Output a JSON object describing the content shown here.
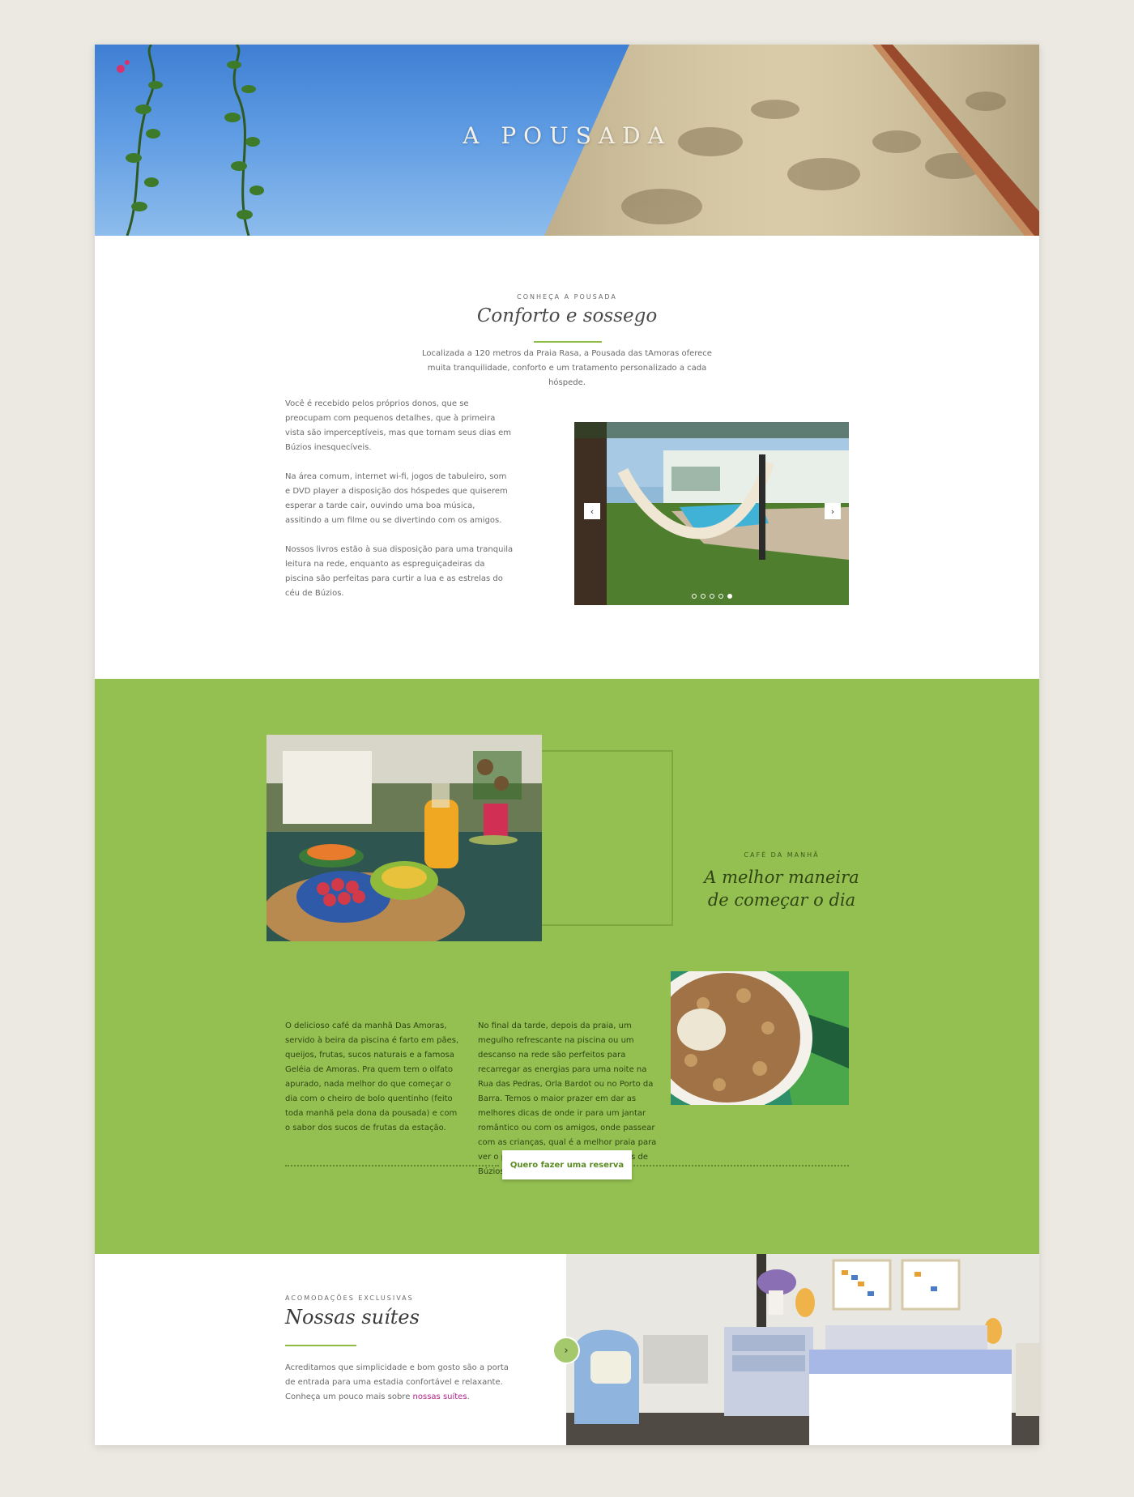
{
  "hero": {
    "title": "A POUSADA"
  },
  "intro": {
    "eyebrow": "CONHEÇA A POUSADA",
    "title": "Conforto e sossego",
    "lead": "Localizada a 120 metros da Praia Rasa, a Pousada das tAmoras oferece muita tranquilidade, conforto e um tratamento personalizado a cada hóspede.",
    "paragraphs": [
      "Você é recebido pelos próprios donos, que se preocupam com pequenos detalhes, que à primeira vista são imperceptíveis, mas que tornam seus dias em Búzios inesquecíveis.",
      "Na área comum, internet wi-fi, jogos de tabuleiro, som e DVD player a disposição dos hóspedes que quiserem esperar a tarde cair, ouvindo uma boa música, assitindo a um filme ou se divertindo com os amigos.",
      "Nossos livros estão à sua disposição para uma tranquila leitura na rede, enquanto as espreguiçadeiras da piscina são perfeitas para curtir a lua e as estrelas do céu de Búzios."
    ],
    "carousel": {
      "prev_icon": "‹",
      "next_icon": "›",
      "slide_count": 5,
      "active_index": 4
    }
  },
  "breakfast": {
    "eyebrow": "CAFÉ DA MANHÃ",
    "title_line1": "A melhor maneira",
    "title_line2": "de começar o dia",
    "text_left": "O delicioso café da manhã Das Amoras, servido à beira da piscina é farto em pães, queijos, frutas, sucos naturais e a famosa Geléia de Amoras. Pra quem tem o olfato apurado, nada melhor do que começar o dia com o cheiro de bolo quentinho (feito toda manhã pela dona da pousada) e com o sabor dos sucos de frutas da estação.",
    "text_right": "No final da tarde, depois da praia, um megulho refrescante na piscina ou um descanso na rede são perfeitos para recarregar as energias para uma noite na Rua das Pedras, Orla Bardot ou no Porto da Barra. Temos o maior prazer em dar as melhores dicas de onde ir para um jantar romântico ou com os amigos, onde passear com as crianças, qual é a melhor praia para ver o por do sol, entre outros segredos de Búzios.",
    "cta": "Quero fazer uma reserva"
  },
  "suites": {
    "eyebrow": "ACOMODAÇÕES EXCLUSIVAS",
    "title": "Nossas suítes",
    "text": "Acreditamos que simplicidade e bom gosto são a porta de entrada para uma estadia confortável e relaxante. Conheça um pouco mais sobre",
    "link": "nossas suítes",
    "text_end": ".",
    "next_icon": "›"
  },
  "colors": {
    "accent_green": "#93c050",
    "rule_green": "#8fbc45",
    "link_magenta": "#b0228b",
    "page_bg": "#ebe9e1"
  }
}
